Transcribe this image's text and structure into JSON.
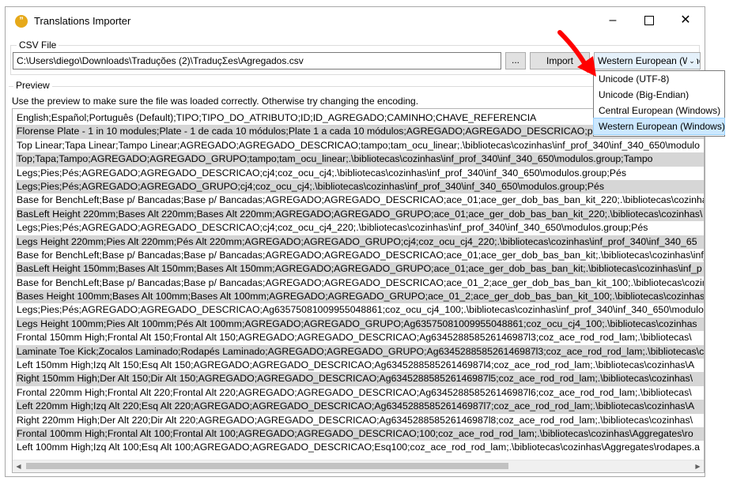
{
  "window": {
    "title": "Translations Importer",
    "controls": {
      "minimize": "–",
      "close": "✕"
    }
  },
  "csv_file": {
    "label": "CSV File",
    "path": "C:\\Users\\diego\\Downloads\\Traduções (2)\\TraduçΣes\\Agregados.csv",
    "browse_label": "...",
    "import_label": "Import",
    "encoding_selected": "Western European (Windows)"
  },
  "encoding_options": [
    "Unicode (UTF-8)",
    "Unicode (Big-Endian)",
    "Central European (Windows)",
    "Western European (Windows)"
  ],
  "preview": {
    "label": "Preview",
    "hint": "Use the preview to make sure the file was loaded correctly. Otherwise try changing the encoding.",
    "lines": [
      "English;Español;Português (Default);TIPO;TIPO_DO_ATRIBUTO;ID;ID_AGREGADO;CAMINHO;CHAVE_REFERENCIA",
      "Florense Plate - 1 in 10 modules;Plate - 1 de cada 10 módulos;Plate 1 a cada 10 módulos;AGREGADO;AGREGADO_DESCRICAO;pl",
      "Top Linear;Tapa Linear;Tampo Linear;AGREGADO;AGREGADO_DESCRICAO;tampo;tam_ocu_linear;.\\bibliotecas\\cozinhas\\inf_prof_340\\inf_340_650\\modulo",
      "Top;Tapa;Tampo;AGREGADO;AGREGADO_GRUPO;tampo;tam_ocu_linear;.\\bibliotecas\\cozinhas\\inf_prof_340\\inf_340_650\\modulos.group;Tampo",
      "Legs;Pies;Pés;AGREGADO;AGREGADO_DESCRICAO;cj4;coz_ocu_cj4;.\\bibliotecas\\cozinhas\\inf_prof_340\\inf_340_650\\modulos.group;Pés",
      "Legs;Pies;Pés;AGREGADO;AGREGADO_GRUPO;cj4;coz_ocu_cj4;.\\bibliotecas\\cozinhas\\inf_prof_340\\inf_340_650\\modulos.group;Pés",
      "Base for BenchLeft;Base p/ Bancadas;Base p/ Bancadas;AGREGADO;AGREGADO_DESCRICAO;ace_01;ace_ger_dob_bas_ban_kit_220;.\\bibliotecas\\cozinhas\\",
      "BasLeft  Height 220mm;Bases Alt 220mm;Bases Alt 220mm;AGREGADO;AGREGADO_GRUPO;ace_01;ace_ger_dob_bas_ban_kit_220;.\\bibliotecas\\cozinhas\\",
      "Legs;Pies;Pés;AGREGADO;AGREGADO_DESCRICAO;cj4;coz_ocu_cj4_220;.\\bibliotecas\\cozinhas\\inf_prof_340\\inf_340_650\\modulos.group;Pés",
      "Legs Height 220mm;Pies Alt 220mm;Pés Alt 220mm;AGREGADO;AGREGADO_GRUPO;cj4;coz_ocu_cj4_220;.\\bibliotecas\\cozinhas\\inf_prof_340\\inf_340_65",
      "Base for BenchLeft;Base p/ Bancadas;Base p/ Bancadas;AGREGADO;AGREGADO_DESCRICAO;ace_01;ace_ger_dob_bas_ban_kit;.\\bibliotecas\\cozinhas\\inf_",
      "BasLeft  Height 150mm;Bases Alt 150mm;Bases Alt 150mm;AGREGADO;AGREGADO_GRUPO;ace_01;ace_ger_dob_bas_ban_kit;.\\bibliotecas\\cozinhas\\inf_p",
      "Base for BenchLeft;Base p/ Bancadas;Base p/ Bancadas;AGREGADO;AGREGADO_DESCRICAO;ace_01_2;ace_ger_dob_bas_ban_kit_100;.\\bibliotecas\\cozinh",
      "Bases Height 100mm;Bases Alt 100mm;Bases Alt 100mm;AGREGADO;AGREGADO_GRUPO;ace_01_2;ace_ger_dob_bas_ban_kit_100;.\\bibliotecas\\cozinhas\\",
      "Legs;Pies;Pés;AGREGADO;AGREGADO_DESCRICAO;Ag63575081009955048861;coz_ocu_cj4_100;.\\bibliotecas\\cozinhas\\inf_prof_340\\inf_340_650\\modulo",
      "Legs Height 100mm;Pies Alt 100mm;Pés Alt 100mm;AGREGADO;AGREGADO_GRUPO;Ag63575081009955048861;coz_ocu_cj4_100;.\\bibliotecas\\cozinhas",
      "Frontal 150mm High;Frontal Alt 150;Frontal Alt 150;AGREGADO;AGREGADO_DESCRICAO;Ag634528858526146987l3;coz_ace_rod_rod_lam;.\\bibliotecas\\",
      "Laminate Toe Kick;Zocalos Laminado;Rodapés Laminado;AGREGADO;AGREGADO_GRUPO;Ag634528858526146987l3;coz_ace_rod_rod_lam;.\\bibliotecas\\c",
      "Left 150mm High;Izq Alt 150;Esq Alt 150;AGREGADO;AGREGADO_DESCRICAO;Ag634528858526146987l4;coz_ace_rod_rod_lam;.\\bibliotecas\\cozinhas\\A",
      "Right 150mm High;Der Alt 150;Dir Alt 150;AGREGADO;AGREGADO_DESCRICAO;Ag634528858526146987l5;coz_ace_rod_rod_lam;.\\bibliotecas\\cozinhas\\",
      "Frontal 220mm High;Frontal Alt 220;Frontal Alt 220;AGREGADO;AGREGADO_DESCRICAO;Ag634528858526146987l6;coz_ace_rod_rod_lam;.\\bibliotecas\\",
      "Left 220mm High;Izq Alt 220;Esq Alt 220;AGREGADO;AGREGADO_DESCRICAO;Ag634528858526146987l7;coz_ace_rod_rod_lam;.\\bibliotecas\\cozinhas\\A",
      "Right 220mm High;Der Alt 220;Dir Alt 220;AGREGADO;AGREGADO_DESCRICAO;Ag634528858526146987l8;coz_ace_rod_rod_lam;.\\bibliotecas\\cozinhas\\",
      "Frontal 100mm High;Frontal Alt 100;Frontal Alt 100;AGREGADO;AGREGADO_DESCRICAO;100;coz_ace_rod_rod_lam;.\\bibliotecas\\cozinhas\\Aggregates\\ro",
      "Left 100mm High;Izq Alt 100;Esq Alt 100;AGREGADO;AGREGADO_DESCRICAO;Esq100;coz_ace_rod_rod_lam;.\\bibliotecas\\cozinhas\\Aggregates\\rodapes.a"
    ]
  },
  "colors": {
    "alt_row": "#d6d6d6",
    "dropdown_highlight": "#cce8ff",
    "annotation_arrow": "#ff0000",
    "app_icon": "#e6a91a"
  },
  "icons": {
    "app": "chat-bubble-icon",
    "dropdown": "chevron-down-icon",
    "scroll_left": "scroll-left-icon",
    "scroll_right": "scroll-right-icon"
  }
}
